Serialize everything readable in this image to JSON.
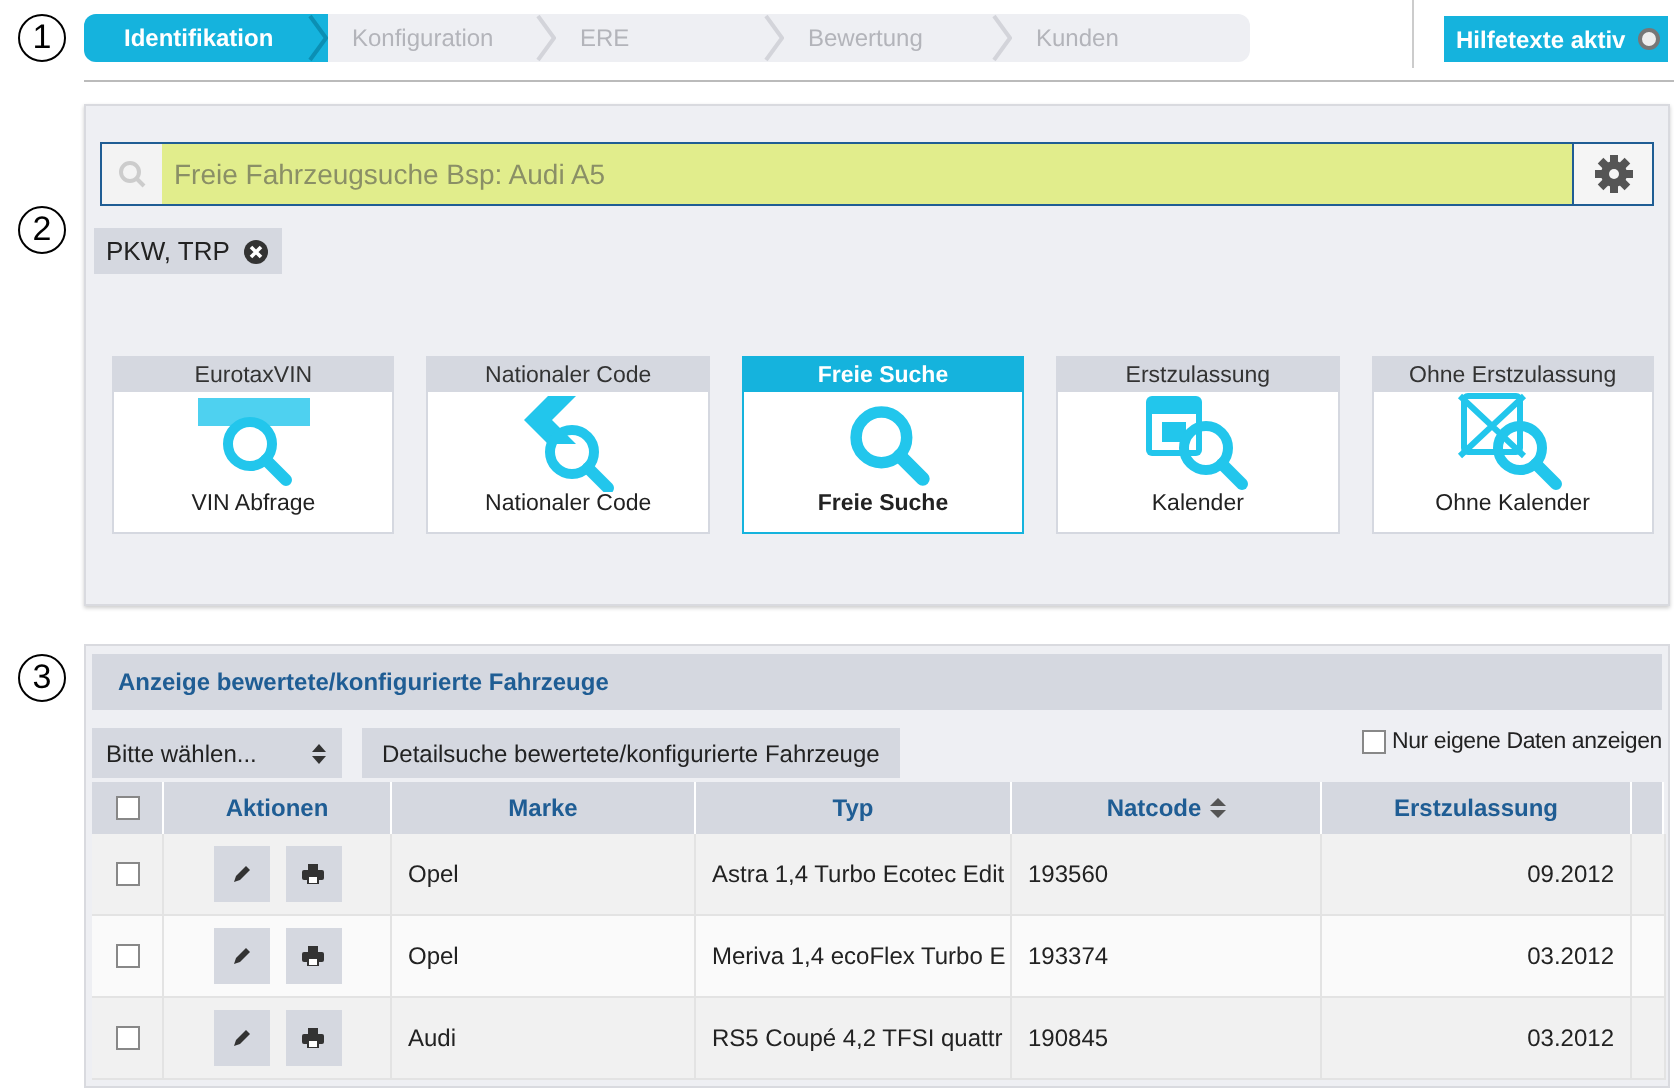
{
  "markers": [
    "1",
    "2",
    "3"
  ],
  "steps": [
    {
      "label": "Identifikation",
      "selected": true
    },
    {
      "label": "Konfiguration",
      "selected": false
    },
    {
      "label": "ERE",
      "selected": false
    },
    {
      "label": "Bewertung",
      "selected": false
    },
    {
      "label": "Kunden",
      "selected": false
    }
  ],
  "help_toggle": {
    "label": "Hilfetexte aktiv",
    "on": false
  },
  "search": {
    "placeholder": "Freie Fahrzeugsuche Bsp: Audi A5"
  },
  "filter_tag": {
    "label": "PKW, TRP"
  },
  "search_modes": [
    {
      "kind": "vin",
      "title": "EurotaxVIN",
      "caption": "VIN Abfrage",
      "selected": false
    },
    {
      "kind": "code",
      "title": "Nationaler Code",
      "caption": "Nationaler Code",
      "selected": false
    },
    {
      "kind": "free",
      "title": "Freie Suche",
      "caption": "Freie Suche",
      "selected": true
    },
    {
      "kind": "calendar",
      "title": "Erstzulassung",
      "caption": "Kalender",
      "selected": false
    },
    {
      "kind": "nocalendar",
      "title": "Ohne Erstzulassung",
      "caption": "Ohne Kalender",
      "selected": false
    }
  ],
  "vehicles": {
    "title": "Anzeige bewertete/konfigurierte Fahrzeuge",
    "select": {
      "value": "Bitte wählen..."
    },
    "detail_button": "Detailsuche bewertete/konfigurierte Fahrzeuge",
    "own_only": {
      "label": "Nur eigene Daten anzeigen",
      "checked": false
    },
    "select_all": {
      "checked": false
    },
    "columns": [
      "Aktionen",
      "Marke",
      "Typ",
      "Natcode",
      "Erstzulassung"
    ],
    "rows": [
      {
        "checked": false,
        "marke": "Opel",
        "typ": "Astra 1,4 Turbo Ecotec Edit",
        "natcode": "193560",
        "erstzulassung": "09.2012"
      },
      {
        "checked": false,
        "marke": "Opel",
        "typ": "Meriva 1,4 ecoFlex Turbo E",
        "natcode": "193374",
        "erstzulassung": "03.2012"
      },
      {
        "checked": false,
        "marke": "Audi",
        "typ": "RS5 Coupé 4,2 TFSI quattr",
        "natcode": "190845",
        "erstzulassung": "03.2012"
      }
    ]
  }
}
